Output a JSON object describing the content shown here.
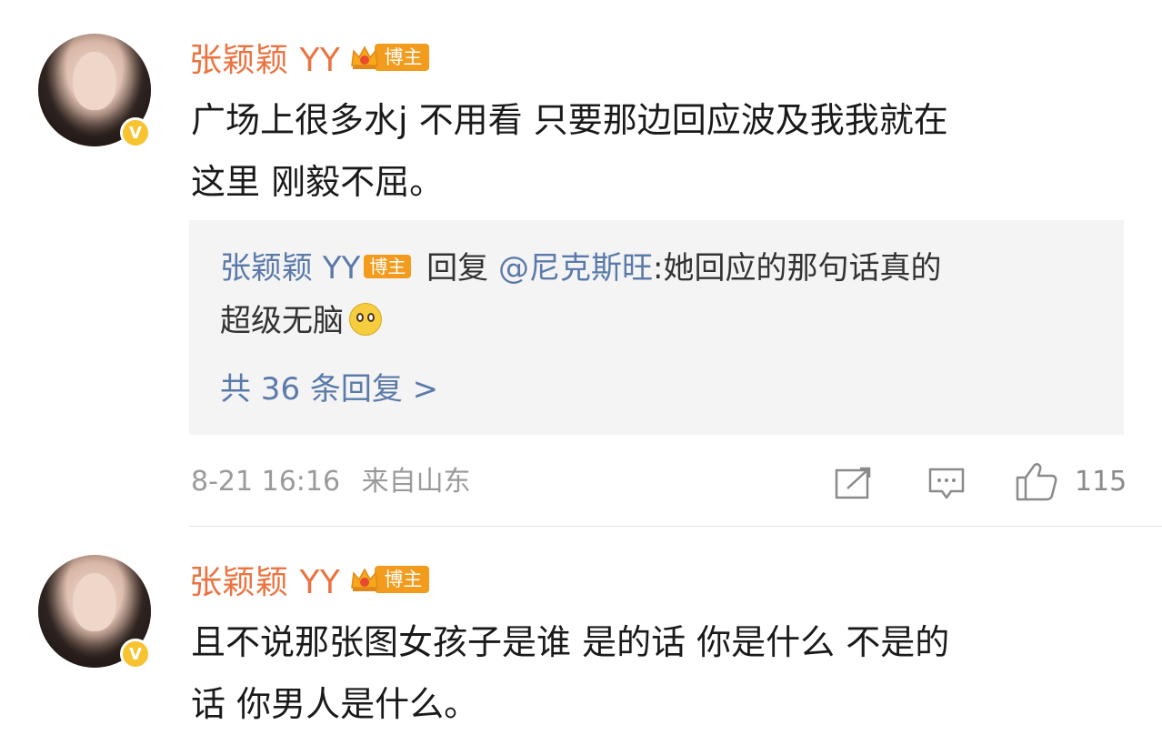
{
  "colors": {
    "username": "#eb7340",
    "reply_username": "#5b7aa9",
    "author_tag_bg": "#f29b1c",
    "reply_bg": "#f4f4f4",
    "meta_text": "#9a9a9a"
  },
  "comments": [
    {
      "username": "张颖颖 YY",
      "author_tag": "博主",
      "verified_mark": "V",
      "text_line1": "广场上很多水j 不用看 只要那边回应波及我我就在",
      "text_line2": "这里 刚毅不屈。",
      "reply": {
        "username": "张颖颖 YY",
        "author_tag": "博主",
        "reply_word": "回复",
        "mention": "@尼克斯旺",
        "text_part1": ":她回应的那句话真的",
        "text_part2": "超级无脑",
        "emoji": "pitiful-face-emoji",
        "more_replies": "共 36 条回复 >"
      },
      "meta": {
        "timestamp": "8-21 16:16",
        "location": "来自山东"
      },
      "actions": {
        "share_icon": "share-icon",
        "comment_icon": "comment-icon",
        "like_icon": "thumbs-up-icon",
        "like_count": "115"
      }
    },
    {
      "username": "张颖颖 YY",
      "author_tag": "博主",
      "verified_mark": "V",
      "text_line1": "且不说那张图女孩子是谁 是的话 你是什么 不是的",
      "text_line2": "话 你男人是什么。"
    }
  ]
}
